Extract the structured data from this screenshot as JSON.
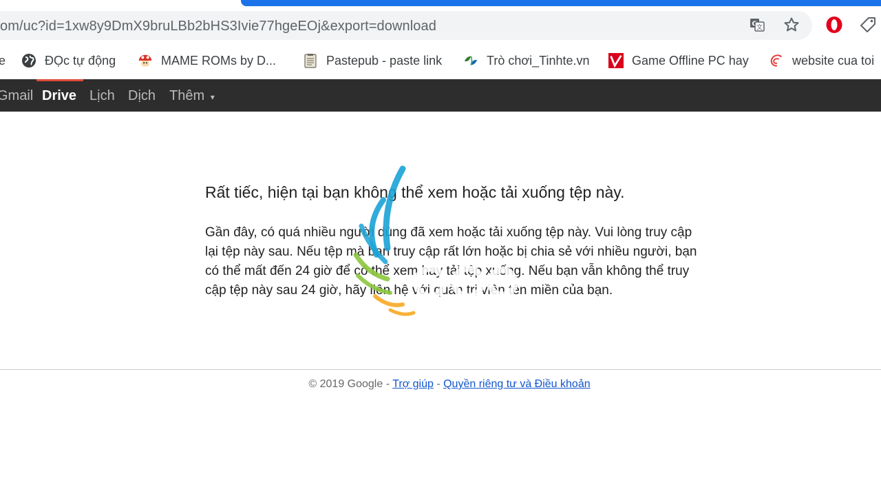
{
  "browser": {
    "url": "om/uc?id=1xw8y9DmX9bruLBb2bHS3Ivie77hgeEOj&export=download",
    "toolbar_icons": [
      "translate-icon",
      "star-icon",
      "opera-icon",
      "tag-icon"
    ],
    "bookmarks": [
      {
        "label": "e",
        "icon": "truncated"
      },
      {
        "label": "ĐỌc tự động",
        "icon": "globe-icon"
      },
      {
        "label": "MAME ROMs by D...",
        "icon": "mushroom-icon"
      },
      {
        "label": "Pastepub - paste link",
        "icon": "document-icon"
      },
      {
        "label": "Trò chơi_Tinhte.vn",
        "icon": "leaf-icon"
      },
      {
        "label": "Game Offline PC hay",
        "icon": "v-logo-icon"
      },
      {
        "label": "website cua toi",
        "icon": "swirl-icon"
      }
    ]
  },
  "google_bar": {
    "items": [
      "Gmail",
      "Drive",
      "Lịch",
      "Dịch",
      "Thêm"
    ],
    "active": "Drive",
    "more_arrow": "▾"
  },
  "message": {
    "title": "Rất tiếc, hiện tại bạn không thể xem hoặc tải xuống tệp này.",
    "body": "Gần đây, có quá nhiều người dùng đã xem hoặc tải xuống tệp này. Vui lòng truy cập lại tệp này sau. Nếu tệp mà bạn truy cập rất lớn hoặc bị chia sẻ với nhiều người, bạn có thể mất đến 24 giờ để có thể xem hay tải tệp xuống. Nếu bạn vẫn không thể truy cập tệp này sau 24 giờ, hãy liên hệ với quản trị viên tên miền của bạn."
  },
  "footer": {
    "copyright": "© 2019 Google - ",
    "help": "Trợ giúp",
    "separator": " - ",
    "privacy": "Quyền riêng tư và Điều khoản"
  },
  "colors": {
    "tab_accent": "#1a73e8",
    "gbar_background": "#2d2d2d",
    "gbar_indicator": "#dd4b39",
    "link": "#1155cc"
  }
}
